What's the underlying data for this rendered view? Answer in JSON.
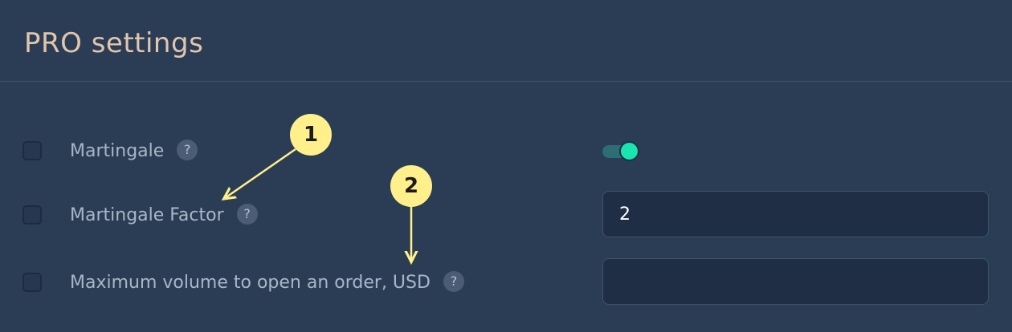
{
  "section": {
    "title": "PRO settings"
  },
  "settings": [
    {
      "label": "Martingale",
      "help": "?",
      "control": "toggle",
      "enabled": true
    },
    {
      "label": "Martingale Factor",
      "help": "?",
      "control": "input",
      "value": "2",
      "placeholder": ""
    },
    {
      "label": "Maximum volume to open an order, USD",
      "help": "?",
      "control": "input",
      "value": "",
      "placeholder": ""
    }
  ],
  "annotations": [
    {
      "number": "1"
    },
    {
      "number": "2"
    }
  ],
  "colors": {
    "background": "#2b3d55",
    "title": "#e2c5ad",
    "toggle_on": "#18e6b0",
    "marker": "#fff08c"
  }
}
